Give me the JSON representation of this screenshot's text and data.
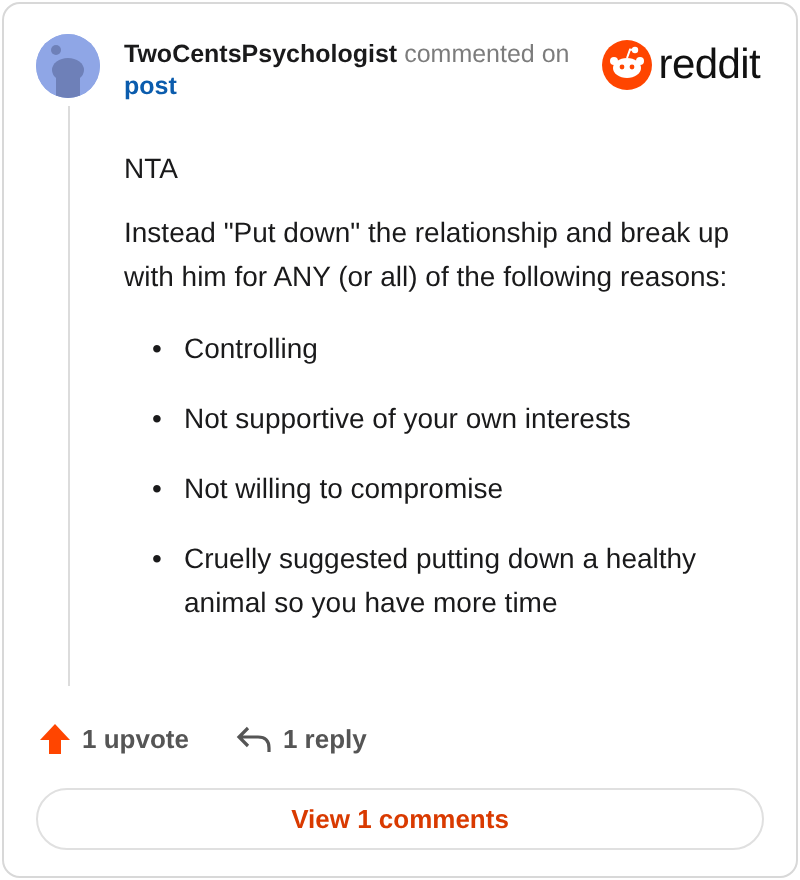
{
  "comment": {
    "author": "TwoCentsPsychologist",
    "action": "commented on",
    "link": "post"
  },
  "brand": {
    "name": "reddit"
  },
  "body": {
    "paragraphs": [
      "NTA",
      "Instead \"Put down\" the relationship and break up with him for ANY (or all) of the following reasons:"
    ],
    "list": [
      {
        "bullet": "•",
        "text": "Controlling"
      },
      {
        "bullet": "•",
        "text": "Not supportive of your own interests"
      },
      {
        "bullet": "•",
        "text": "Not willing to compromise"
      },
      {
        "bullet": "•",
        "text": "Cruelly suggested putting down a healthy animal so you have more time"
      }
    ]
  },
  "footer": {
    "upvotes": "1 upvote",
    "replies": "1 reply"
  },
  "view_button": "View 1 comments"
}
